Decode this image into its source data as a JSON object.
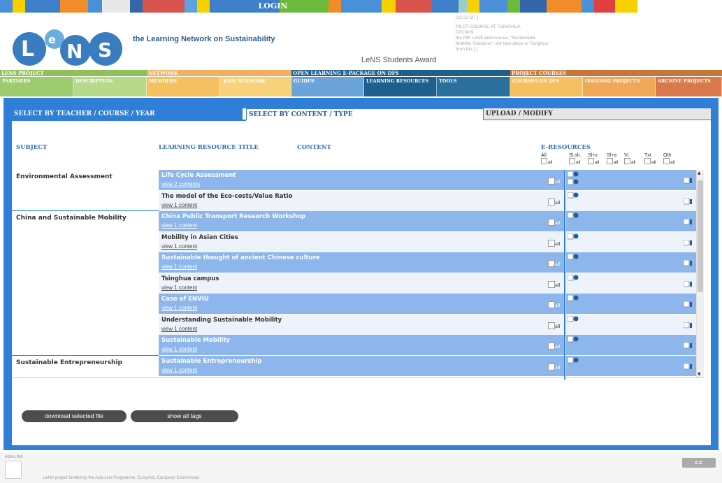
{
  "top": {
    "login_label": "LOGIN",
    "strip_colors": [
      "#4a90d9",
      "#f7d000",
      "#3d7fc9",
      "#f28c28",
      "#4a90d9",
      "#e8e8e8",
      "#3366aa",
      "#d9534f",
      "#5ba3e0",
      "#f7d000",
      "#3d7fc9",
      "#3d7fc9",
      "#6cba3b",
      "#f28c28",
      "#4a90d9",
      "#f7d000",
      "#d9534f",
      "#3d7fc9",
      "#9cc",
      "#f7d000",
      "#4a90d9",
      "#6cba3b",
      "#3366aa",
      "#f28c28",
      "#4a90d9",
      "#e04040",
      "#f7d000"
    ]
  },
  "header": {
    "logo_text": "LeNS",
    "tagline": "the Learning Network on Sustainability",
    "award": "LeNS Students Award",
    "news": [
      "[11-22 M [ ]",
      "PILOT COURSE AT TSINGHUA",
      "07/10/09",
      "the fifth LeNS pilot course, \"Sustainable",
      "Mobility Solutions\", will take place at Tsinghua",
      "from the [ ]"
    ]
  },
  "nav": {
    "groups": [
      {
        "label": "LENS PROJECT",
        "color": "#8fc15a"
      },
      {
        "label": "NETWORK",
        "color": "#f0b060"
      },
      {
        "label": "OPEN LEARNING E-PACKAGE ON DFS",
        "color": "#1e5f8e"
      },
      {
        "label": "PROJECT COURSES",
        "color": "#c9763a"
      }
    ],
    "items": [
      {
        "label": "PARTNERS",
        "color": "#9ccc6e"
      },
      {
        "label": "DESCRIPTION",
        "color": "#b6d98a"
      },
      {
        "label": "MEMBERS",
        "color": "#f5c060"
      },
      {
        "label": "JOIN NETWORK",
        "color": "#f7d27a"
      },
      {
        "label": "GUIDES",
        "color": "#6aa4d8"
      },
      {
        "label": "LEARNING RESOURCES",
        "color": "#1e5f8e"
      },
      {
        "label": "TOOLS",
        "color": "#2b6f9e"
      },
      {
        "label": "COURSES ON DFS",
        "color": "#f5c060"
      },
      {
        "label": "ONGOING PROJECTS",
        "color": "#f0a858"
      },
      {
        "label": "ARCHIVE PROJECTS",
        "color": "#d9784a"
      }
    ]
  },
  "tabs": {
    "by_teacher": "SELECT BY TEACHER / COURSE / YEAR",
    "by_content": "SELECT BY CONTENT / TYPE",
    "upload": "UPLOAD / MODIFY"
  },
  "columns": {
    "subject": "SUBJECT",
    "title": "LEARNING RESOURCE TITLE",
    "content": "CONTENT",
    "eresources": "E-RESOURCES",
    "types": [
      "All",
      "Sl.sh.",
      "Sl+v",
      "Sl+a",
      "Vi.",
      "Txt",
      "Oth"
    ],
    "all_label": "all"
  },
  "subjects": [
    "Environmental Assessment",
    "China and Sustainable Mobility",
    "Sustainable Entrepreneurship"
  ],
  "resources": [
    {
      "title": "Life Cycle Assessment",
      "link": "view 2 contents"
    },
    {
      "title": "The model of the Eco-costs/Value Ratio",
      "link": "view 1 content"
    },
    {
      "title": "China Public Transport Research Workshop",
      "link": "view 1 content"
    },
    {
      "title": "Mobility in Asian Cities",
      "link": "view 1 content"
    },
    {
      "title": "Sustainable thought of ancient Chinese culture",
      "link": "view 1 content"
    },
    {
      "title": "Tsinghua campus",
      "link": "view 1 content"
    },
    {
      "title": "Case of ENVIU",
      "link": "view 1 content"
    },
    {
      "title": "Understanding Sustainable Mobility",
      "link": "view 1 content"
    },
    {
      "title": "Sustainable Mobility",
      "link": "view 1 content"
    },
    {
      "title": "Sustainable Entrepreneurship",
      "link": "view 1 content"
    }
  ],
  "buttons": {
    "download": "download selected file",
    "show_tags": "show all tags"
  },
  "footer": {
    "tag": "ASIA LINK",
    "text": "LeNS project funded by the Asia Link Programme, EuropAid, European Commission",
    "license": "cc"
  }
}
